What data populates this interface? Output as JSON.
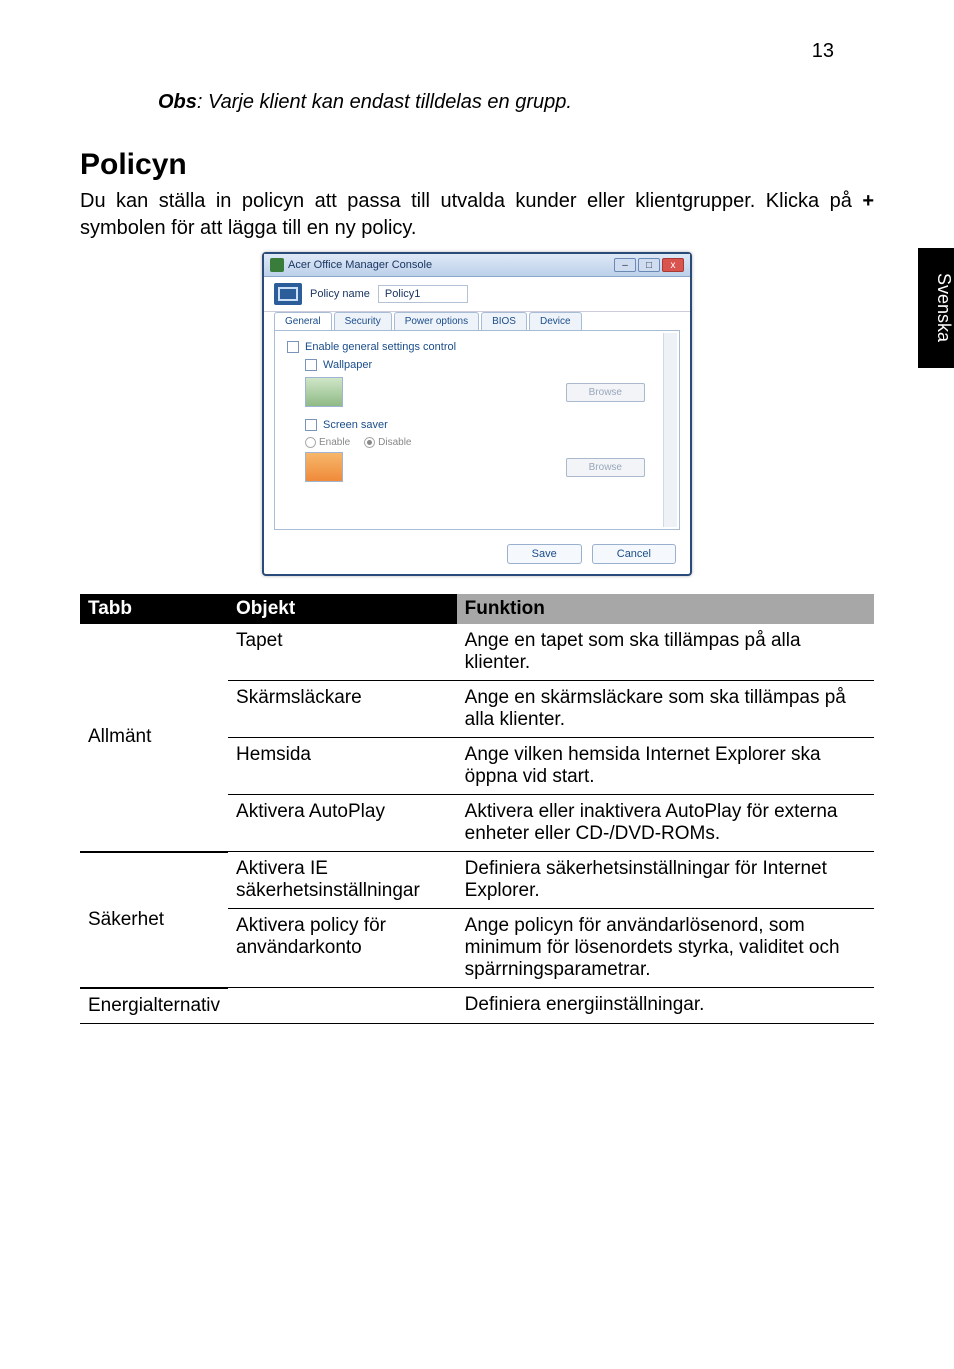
{
  "page_number": "13",
  "side_tab": "Svenska",
  "obs": {
    "label": "Obs",
    "text": ": Varje klient kan endast tilldelas en grupp."
  },
  "heading": "Policyn",
  "body": {
    "line1": "Du kan ställa in policyn att passa till utvalda kunder eller klientgrupper. Klicka på ",
    "plus": "+",
    "line2": " symbolen för att lägga till en ny policy."
  },
  "screenshot": {
    "title": "Acer Office Manager Console",
    "policy_name_label": "Policy name",
    "policy_name_value": "Policy1",
    "tabs": [
      "General",
      "Security",
      "Power options",
      "BIOS",
      "Device"
    ],
    "enable_general": "Enable general settings control",
    "wallpaper": "Wallpaper",
    "screensaver": "Screen saver",
    "enable": "Enable",
    "disable": "Disable",
    "browse": "Browse",
    "save": "Save",
    "cancel": "Cancel"
  },
  "table": {
    "headers": {
      "tab": "Tabb",
      "object": "Objekt",
      "function": "Funktion"
    },
    "rows": [
      {
        "tab": "Allmänt",
        "items": [
          {
            "object": "Tapet",
            "function": "Ange en tapet som ska tillämpas på alla klienter."
          },
          {
            "object": "Skärmsläckare",
            "function": "Ange en skärmsläckare som ska tillämpas på alla klienter."
          },
          {
            "object": "Hemsida",
            "function": "Ange vilken hemsida Internet Explorer ska öppna vid start."
          },
          {
            "object": "Aktivera AutoPlay",
            "function": "Aktivera eller inaktivera AutoPlay för externa enheter eller CD-/DVD-ROMs."
          }
        ]
      },
      {
        "tab": "Säkerhet",
        "items": [
          {
            "object": "Aktivera IE säkerhetsinställningar",
            "function": "Definiera säkerhetsinställningar för Internet Explorer."
          },
          {
            "object": "Aktivera policy för användarkonto",
            "function": "Ange policyn för användarlösenord, som minimum för lösenordets styrka, validitet och spärrningsparametrar."
          }
        ]
      },
      {
        "tab": "Energialternativ",
        "items": [
          {
            "object": "",
            "function": "Definiera energiinställningar."
          }
        ]
      }
    ]
  }
}
